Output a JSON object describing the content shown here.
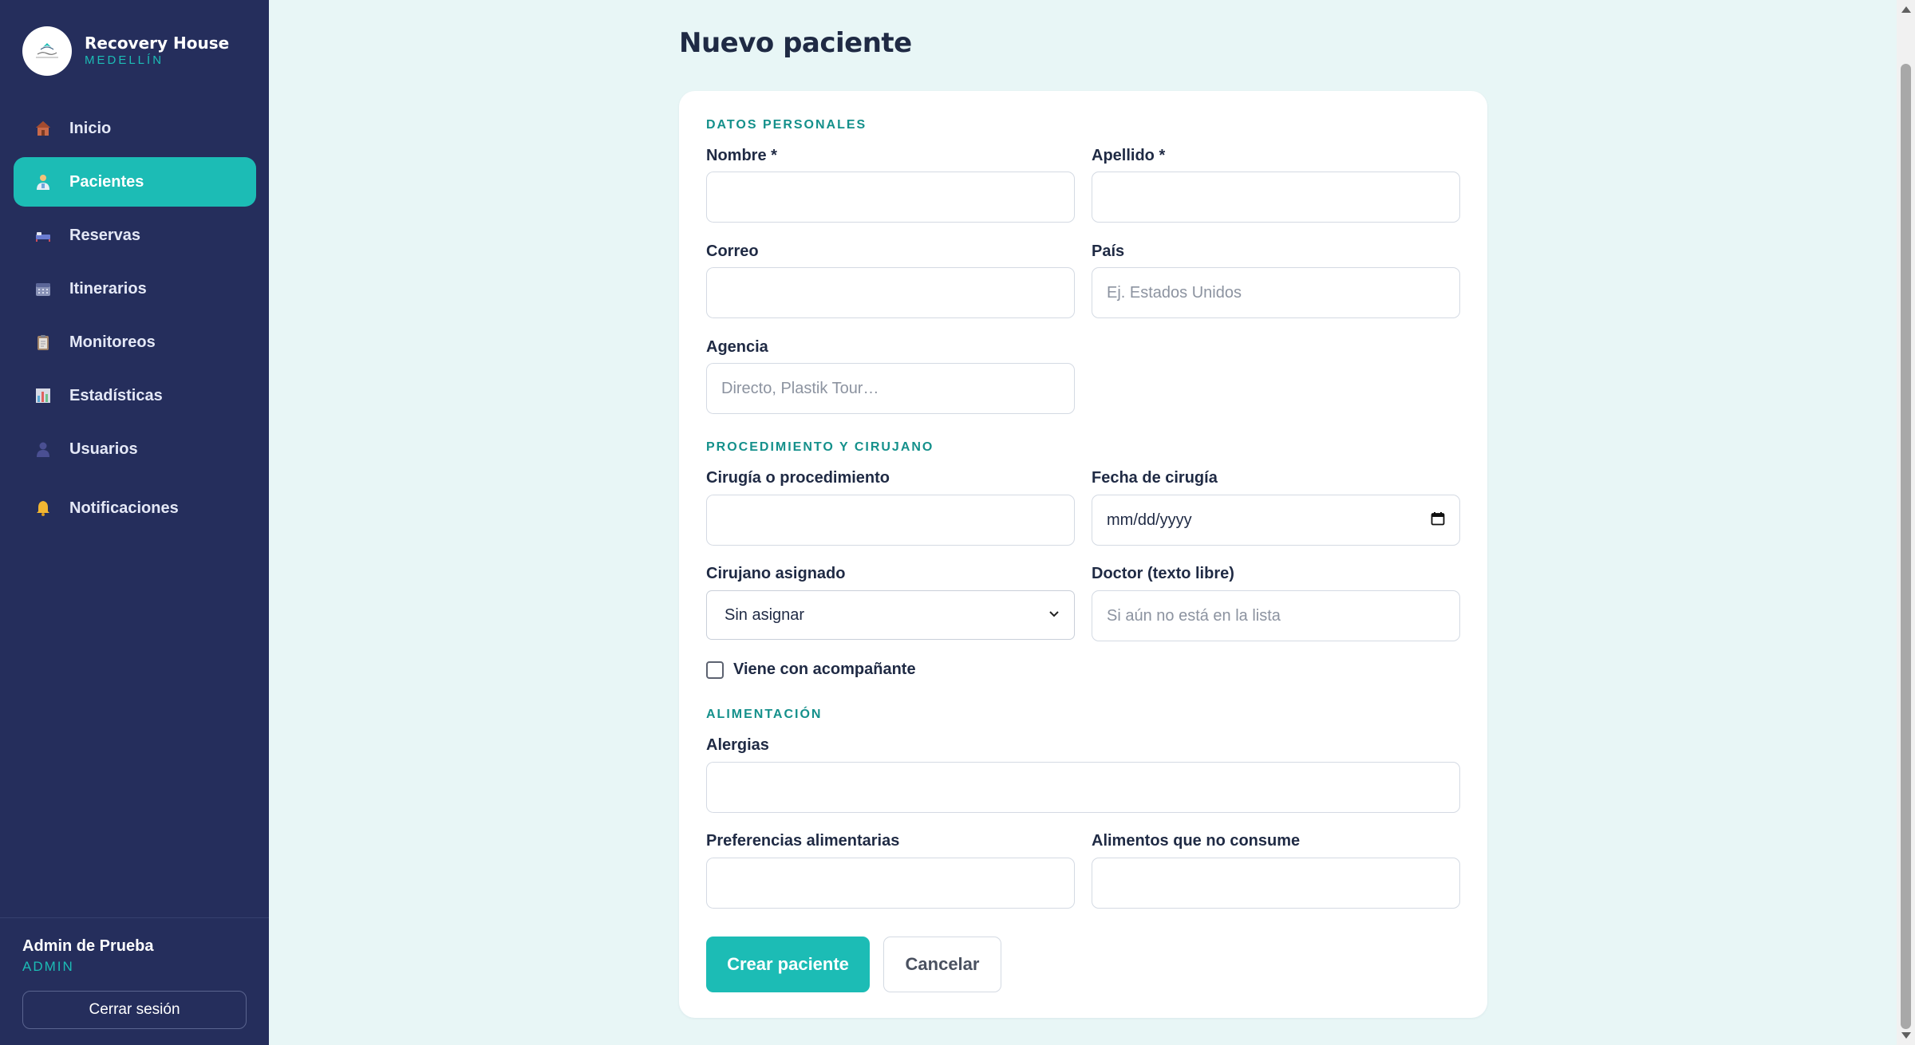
{
  "brand": {
    "name": "Recovery House",
    "city": "MEDELLÍN"
  },
  "nav": {
    "items": [
      {
        "label": "Inicio",
        "icon": "house-icon"
      },
      {
        "label": "Pacientes",
        "icon": "patient-icon",
        "active": true
      },
      {
        "label": "Reservas",
        "icon": "bed-icon"
      },
      {
        "label": "Itinerarios",
        "icon": "calendar-icon"
      },
      {
        "label": "Monitoreos",
        "icon": "clipboard-icon"
      },
      {
        "label": "Estadísticas",
        "icon": "bar-chart-icon"
      },
      {
        "label": "Usuarios",
        "icon": "user-icon"
      },
      {
        "label": "Notificaciones",
        "icon": "bell-icon"
      }
    ]
  },
  "user": {
    "name": "Admin de Prueba",
    "role": "ADMIN",
    "logout_label": "Cerrar sesión"
  },
  "page": {
    "title": "Nuevo paciente"
  },
  "form": {
    "personal": {
      "title": "DATOS PERSONALES",
      "nombre": {
        "label": "Nombre *",
        "value": "",
        "placeholder": ""
      },
      "apellido": {
        "label": "Apellido *",
        "value": "",
        "placeholder": ""
      },
      "correo": {
        "label": "Correo",
        "value": "",
        "placeholder": ""
      },
      "pais": {
        "label": "País",
        "value": "",
        "placeholder": "Ej. Estados Unidos"
      },
      "agencia": {
        "label": "Agencia",
        "value": "",
        "placeholder": "Directo, Plastik Tour…"
      }
    },
    "procedure": {
      "title": "PROCEDIMIENTO Y CIRUJANO",
      "cirugia": {
        "label": "Cirugía o procedimiento",
        "value": "",
        "placeholder": ""
      },
      "fecha": {
        "label": "Fecha de cirugía",
        "value": "mm/dd/yyyy"
      },
      "cirujano": {
        "label": "Cirujano asignado",
        "selected": "Sin asignar"
      },
      "doctor": {
        "label": "Doctor (texto libre)",
        "value": "",
        "placeholder": "Si aún no está en la lista"
      },
      "acompanante": {
        "label": "Viene con acompañante",
        "checked": false
      }
    },
    "food": {
      "title": "ALIMENTACIÓN",
      "alergias": {
        "label": "Alergias",
        "value": "",
        "placeholder": ""
      },
      "preferencias": {
        "label": "Preferencias alimentarias",
        "value": "",
        "placeholder": ""
      },
      "no_consume": {
        "label": "Alimentos que no consume",
        "value": "",
        "placeholder": ""
      }
    },
    "actions": {
      "create_label": "Crear paciente",
      "cancel_label": "Cancelar"
    }
  },
  "colors": {
    "sidebar": "#252e5c",
    "accent": "#1cbcb5",
    "section": "#14908b",
    "background": "#e8f6f6"
  }
}
